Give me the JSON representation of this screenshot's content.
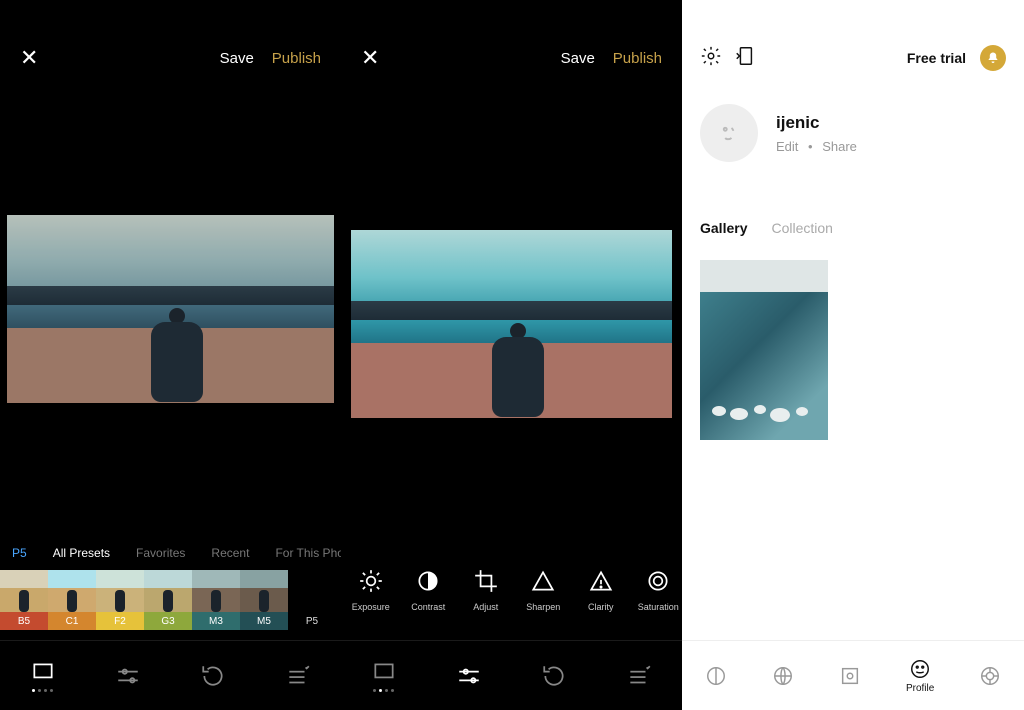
{
  "panel1": {
    "save_label": "Save",
    "publish_label": "Publish",
    "preset_tabs": {
      "current": "P5",
      "all": "All Presets",
      "favorites": "Favorites",
      "recent": "Recent",
      "forthis": "For This Photo"
    },
    "filmstrip": [
      {
        "label": "B5",
        "color": "#c44b2f",
        "sky": "#d9d1b8",
        "ground": "#c9a86b"
      },
      {
        "label": "C1",
        "color": "#d4862e",
        "sky": "#aee2ec",
        "ground": "#cfa96e"
      },
      {
        "label": "F2",
        "color": "#e6c23a",
        "sky": "#cde2d9",
        "ground": "#cbb27a"
      },
      {
        "label": "G3",
        "color": "#8ea83c",
        "sky": "#bcd8d8",
        "ground": "#bba76e"
      },
      {
        "label": "M3",
        "color": "#2f6d6d",
        "sky": "#9fb8b8",
        "ground": "#7a6655"
      },
      {
        "label": "M5",
        "color": "#234f55",
        "sky": "#88a2a2",
        "ground": "#6b5b4c"
      },
      {
        "label": "P5",
        "color": "#000000",
        "sky": "#000000",
        "ground": "#000000"
      }
    ],
    "bottom_nav": [
      "presets",
      "edit",
      "history",
      "recipes"
    ]
  },
  "panel2": {
    "save_label": "Save",
    "publish_label": "Publish",
    "tools": [
      {
        "label": "Exposure",
        "icon": "sun"
      },
      {
        "label": "Contrast",
        "icon": "halfcircle"
      },
      {
        "label": "Adjust",
        "icon": "crop"
      },
      {
        "label": "Sharpen",
        "icon": "triangle"
      },
      {
        "label": "Clarity",
        "icon": "warning"
      },
      {
        "label": "Saturation",
        "icon": "ring"
      }
    ],
    "bottom_nav": [
      "presets",
      "edit",
      "history",
      "recipes"
    ]
  },
  "panel3": {
    "free_trial": "Free trial",
    "username": "ijenic",
    "edit": "Edit",
    "share": "Share",
    "tabs": {
      "gallery": "Gallery",
      "collection": "Collection"
    },
    "bottom_nav": {
      "profile_label": "Profile"
    }
  }
}
